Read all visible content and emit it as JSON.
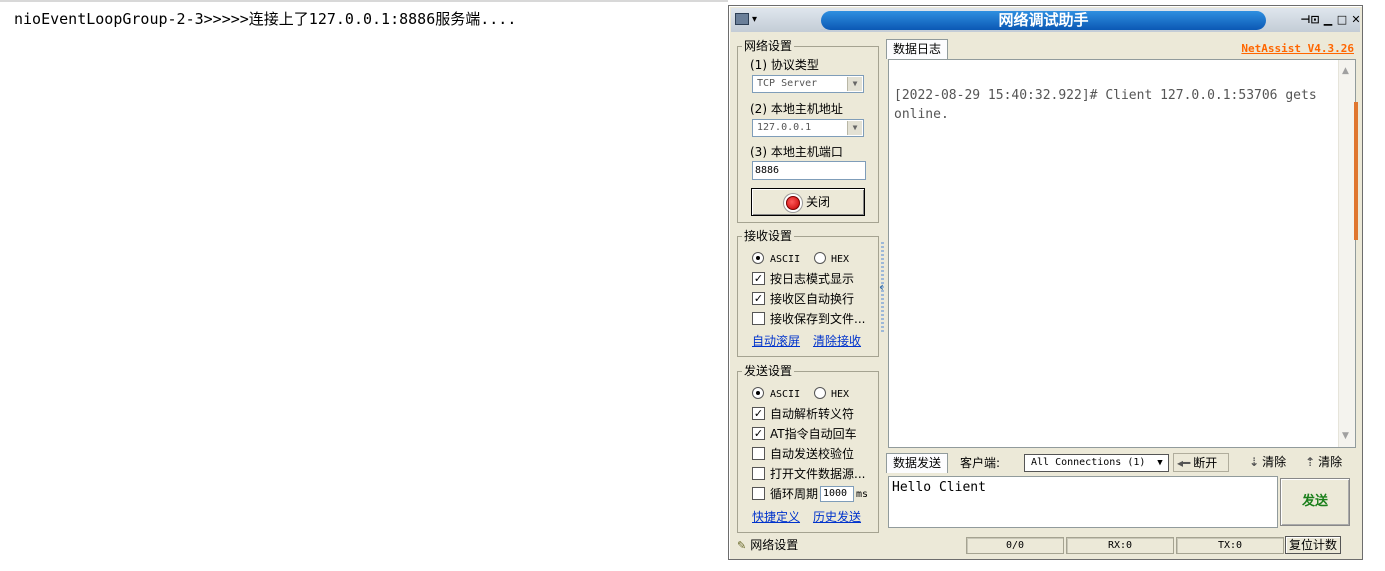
{
  "console": {
    "line": "nioEventLoopGroup-2-3>>>>>连接上了127.0.0.1:8886服务端...."
  },
  "window": {
    "title": "网络调试助手",
    "version": "NetAssist V4.3.26",
    "controls": {
      "pin": "⊣⊡",
      "minimize": "▁",
      "maximize": "□",
      "close": "✕"
    }
  },
  "network": {
    "group_title": "网络设置",
    "protocol_label": "(1) 协议类型",
    "protocol_value": "TCP Server",
    "host_label": "(2) 本地主机地址",
    "host_value": "127.0.0.1",
    "port_label": "(3) 本地主机端口",
    "port_value": "8886",
    "close_button": "关闭"
  },
  "receive": {
    "group_title": "接收设置",
    "ascii": "ASCII",
    "hex": "HEX",
    "selected": "ASCII",
    "options": [
      {
        "label": "按日志模式显示",
        "checked": true
      },
      {
        "label": "接收区自动换行",
        "checked": true
      },
      {
        "label": "接收保存到文件...",
        "checked": false
      }
    ],
    "link_auto_scroll": "自动滚屏",
    "link_clear": "清除接收"
  },
  "send": {
    "group_title": "发送设置",
    "ascii": "ASCII",
    "hex": "HEX",
    "selected": "ASCII",
    "options": [
      {
        "label": "自动解析转义符",
        "checked": true
      },
      {
        "label": "AT指令自动回车",
        "checked": true
      },
      {
        "label": "自动发送校验位",
        "checked": false
      },
      {
        "label": "打开文件数据源...",
        "checked": false
      }
    ],
    "cycle_label": "循环周期",
    "cycle_checked": false,
    "cycle_value": "1000",
    "cycle_unit": "ms",
    "link_shortcuts": "快捷定义",
    "link_history": "历史发送"
  },
  "log": {
    "tab": "数据日志",
    "text": "[2022-08-29 15:40:32.922]# Client 127.0.0.1:53706 gets online."
  },
  "sendbar": {
    "tab": "数据发送",
    "client_label": "客户端:",
    "connections": "All Connections (1)",
    "disconnect": "断开",
    "clear1": "清除",
    "clear2": "清除",
    "message": "Hello Client",
    "send_button": "发送"
  },
  "status": {
    "left": "网络设置",
    "counter": "0/0",
    "rx": "RX:0",
    "tx": "TX:0",
    "reset": "复位计数"
  },
  "colors": {
    "title_pill": "#0b58b4",
    "version": "#ff6600",
    "send_button_text": "#1a7f1a",
    "link": "#0033cc",
    "scroll_accent": "#e0762f"
  }
}
